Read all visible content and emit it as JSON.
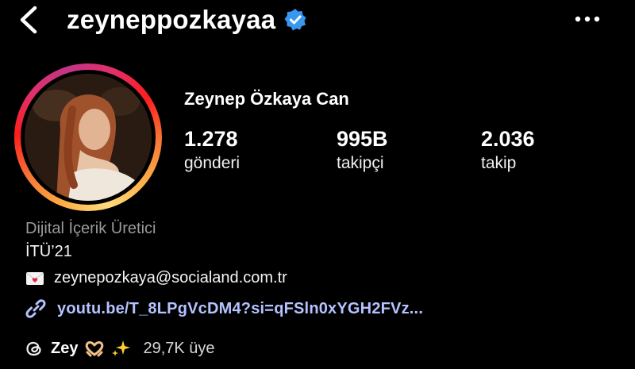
{
  "header": {
    "username": "zeyneppozkayaa",
    "back_icon": "chevron-left-icon",
    "verified_icon": "verified-badge-icon",
    "more_icon": "more-horizontal-icon",
    "verified_color": "#3897f0"
  },
  "profile": {
    "full_name": "Zeynep Özkaya Can",
    "stats": [
      {
        "value": "1.278",
        "label": "gönderi"
      },
      {
        "value": "995B",
        "label": "takipçi"
      },
      {
        "value": "2.036",
        "label": "takip"
      }
    ]
  },
  "bio": {
    "category": "Dijital İçerik Üretici",
    "line1": "İTÜ’21",
    "email": "zeynepozkaya@socialand.com.tr",
    "email_icon": "love-letter-icon",
    "link": "youtu.be/T_8LPgVcDM4?si=qFSln0xYGH2FVz...",
    "link_icon": "link-icon",
    "link_color": "#b4c2ff"
  },
  "threads": {
    "icon": "threads-icon",
    "name": "Zey",
    "emoji_icons": [
      "heart-hands-icon",
      "sparkles-icon"
    ],
    "members": "29,7K üye"
  }
}
